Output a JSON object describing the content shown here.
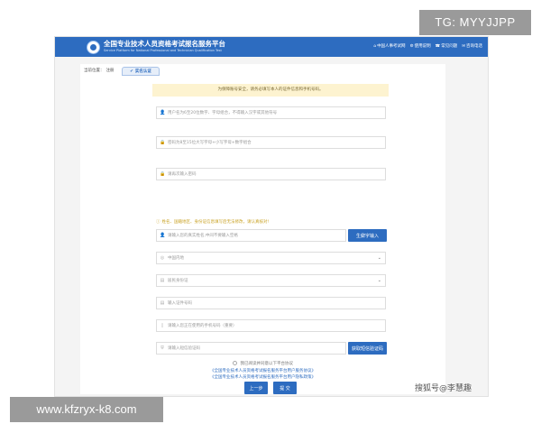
{
  "overlay": {
    "tag_top": "TG: MYYJJPP",
    "tag_bottom": "www.kfzryx-k8.com",
    "watermark": "搜狐号@李慧趣"
  },
  "header": {
    "title": "全国专业技术人员资格考试报名服务平台",
    "subtitle": "Service Platform for National Professional and Technician Qualification Test",
    "nav": [
      {
        "icon": "home-icon",
        "label": "中国人事考试网"
      },
      {
        "icon": "gear-icon",
        "label": "使用说明"
      },
      {
        "icon": "phone-icon",
        "label": "常见问题"
      },
      {
        "icon": "chat-icon",
        "label": "咨询电话"
      }
    ],
    "brand_color": "#2d6cc0"
  },
  "breadcrumb": {
    "prefix": "当前位置：",
    "current": "注册",
    "step": "实名认证"
  },
  "notice": "为保障账号安全，请务必填写本人的证件信息和手机号码。",
  "form": {
    "username_placeholder": "用户名为6至20位数字、字母组合，不得输入汉字或其他符号",
    "password_placeholder": "密码为8至15位大写字母+小写字母+数字组合",
    "confirm_placeholder": "请再次输入密码",
    "warning": "姓名、国籍地区、身份证信息填写后无法修改，请认真核对!",
    "name_placeholder": "请输入您的真实姓名,中间不要输入空格",
    "rare_char_button": "生僻字输入",
    "country_value": "中国内地",
    "id_type_value": "居民身份证",
    "id_number_placeholder": "输入证件号码",
    "phone_placeholder": "请输入您正在使用的手机号码（重要）",
    "sms_placeholder": "请输入短信验证码",
    "sms_button": "获取短信验证码"
  },
  "agreement": {
    "text": "我已阅读并同意以下平台协议",
    "link1": "《全国专业技术人员资格考试报名服务平台用户服务协议》",
    "link2": "《全国专业技术人员资格考试报名服务平台用户隐私政策》"
  },
  "buttons": {
    "prev": "上一步",
    "submit": "提 交"
  }
}
